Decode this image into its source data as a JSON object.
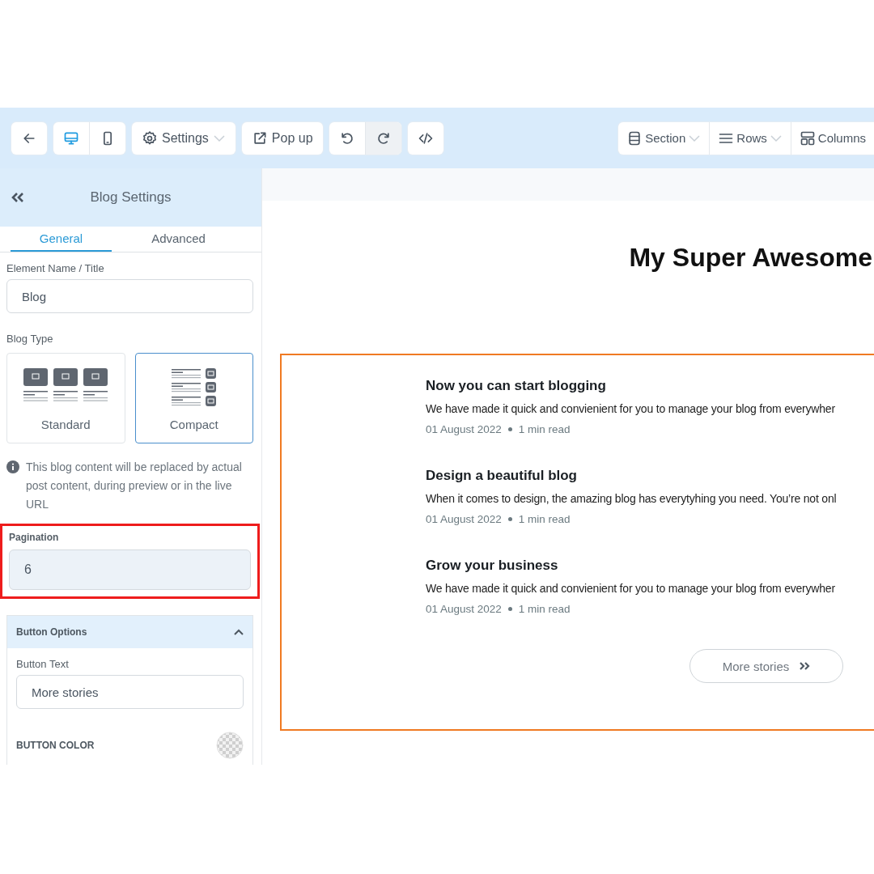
{
  "toolbar": {
    "left_groups": [
      [
        {
          "kind": "back"
        }
      ],
      [
        {
          "kind": "desktop",
          "selected": true
        },
        {
          "kind": "mobile",
          "selected": false
        }
      ],
      [
        {
          "kind": "settings",
          "label": "Settings",
          "dropdown": true
        }
      ],
      [
        {
          "kind": "popup",
          "label": "Pop up"
        }
      ],
      [
        {
          "kind": "undo",
          "highlighted": false
        },
        {
          "kind": "redo",
          "highlighted": true
        }
      ],
      [
        {
          "kind": "code"
        }
      ]
    ],
    "right_group": [
      {
        "kind": "section",
        "label": "Section",
        "dropdown": true
      },
      {
        "kind": "rows",
        "label": "Rows",
        "dropdown": true
      },
      {
        "kind": "columns",
        "label": "Columns",
        "dropdown": false
      }
    ]
  },
  "sidebar": {
    "title": "Blog Settings",
    "tabs": [
      {
        "label": "General",
        "selected": true
      },
      {
        "label": "Advanced",
        "selected": false
      }
    ],
    "name_field": {
      "label": "Element Name / Title",
      "value": "Blog"
    },
    "blog_type": {
      "label": "Blog Type",
      "options": [
        {
          "kind": "standard",
          "label": "Standard",
          "selected": false
        },
        {
          "kind": "compact",
          "label": "Compact",
          "selected": true
        }
      ]
    },
    "note": "This blog content will be replaced by actual post content, during preview or in the live URL",
    "pagination": {
      "label": "Pagination",
      "value": "6",
      "highlighted": true
    },
    "button_options": {
      "title": "Button Options",
      "expanded": true,
      "button_text_label": "Button Text",
      "button_text": "More stories",
      "color_label": "BUTTON COLOR"
    }
  },
  "canvas": {
    "title": "My Super Awesome",
    "posts": [
      {
        "title": "Now you can start blogging",
        "excerpt": "We have made it quick and convienient for you to manage your blog from everywher",
        "date": "01 August 2022",
        "read_time": "1 min read"
      },
      {
        "title": "Design a beautiful blog",
        "excerpt": "When it comes to design, the amazing blog has everytyhing you need. You’re not onl",
        "date": "01 August 2022",
        "read_time": "1 min read"
      },
      {
        "title": "Grow your business",
        "excerpt": "We have made it quick and convienient for you to manage your blog from everywher",
        "date": "01 August 2022",
        "read_time": "1 min read"
      }
    ],
    "more_button": "More stories"
  }
}
